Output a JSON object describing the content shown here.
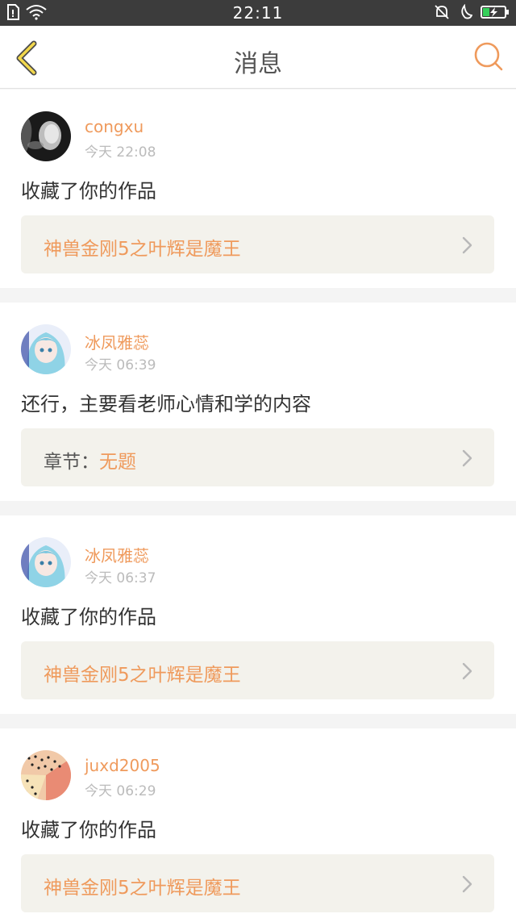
{
  "status_bar": {
    "time": "22:11",
    "icons_left": [
      "sim-icon",
      "wifi-icon"
    ],
    "icons_right": [
      "silent-bell-icon",
      "moon-icon",
      "battery-charging-icon"
    ],
    "battery_color": "#35d05a"
  },
  "header": {
    "title": "消息",
    "back_icon": "chevron-left-icon",
    "search_icon": "search-icon",
    "accent_color": "#ef9a5c"
  },
  "messages": [
    {
      "user": "congxu",
      "time": "今天 22:08",
      "text": "收藏了你的作品",
      "ref_prefix": "",
      "ref_title": "神兽金刚5之叶辉是魔王"
    },
    {
      "user": "冰凤雅蕊",
      "time": "今天 06:39",
      "text": "还行，主要看老师心情和学的内容",
      "ref_prefix": "章节：",
      "ref_title": "无题"
    },
    {
      "user": "冰凤雅蕊",
      "time": "今天 06:37",
      "text": "收藏了你的作品",
      "ref_prefix": "",
      "ref_title": "神兽金刚5之叶辉是魔王"
    },
    {
      "user": "juxd2005",
      "time": "今天 06:29",
      "text": "收藏了你的作品",
      "ref_prefix": "",
      "ref_title": "神兽金刚5之叶辉是魔王"
    }
  ]
}
